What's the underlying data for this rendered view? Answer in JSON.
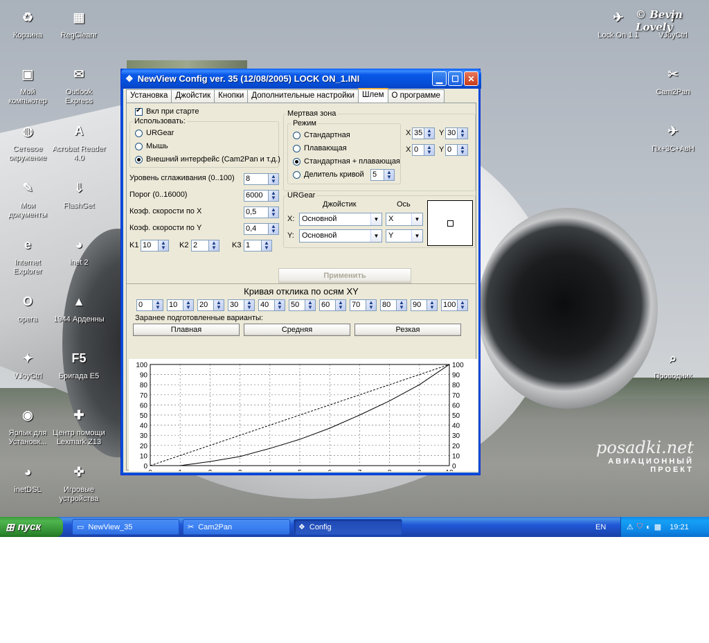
{
  "desktop": {
    "icons_left": [
      {
        "label": "Корзина",
        "glyph": "♻"
      },
      {
        "label": "RegCleanr",
        "glyph": "▦"
      },
      {
        "label": "Мой компьютер",
        "glyph": "▣"
      },
      {
        "label": "Outlook Express",
        "glyph": "✉"
      },
      {
        "label": "Сетевое окружение",
        "glyph": "◍"
      },
      {
        "label": "Acrobat Reader 4.0",
        "glyph": "A"
      },
      {
        "label": "Мои документы",
        "glyph": "✎"
      },
      {
        "label": "FlashGet",
        "glyph": "⇓"
      },
      {
        "label": "Internet Explorer",
        "glyph": "e"
      },
      {
        "label": "inet 2",
        "glyph": "◕"
      },
      {
        "label": "opera",
        "glyph": "O"
      },
      {
        "label": "1944 Арденны",
        "glyph": "▲"
      },
      {
        "label": "VJoyCtrl",
        "glyph": "✦"
      },
      {
        "label": "Бригада E5",
        "glyph": "F5"
      },
      {
        "label": "Ярлык для Установк...",
        "glyph": "◉"
      },
      {
        "label": "Центр помощи Lexmark Z13",
        "glyph": "✚"
      },
      {
        "label": "inetDSL",
        "glyph": "◕"
      },
      {
        "label": "Игровые устройства",
        "glyph": "✜"
      }
    ],
    "icons_right": [
      {
        "label": "Lock On 1.1",
        "glyph": "✈"
      },
      {
        "label": "VJoyCtrl",
        "glyph": "7"
      },
      {
        "label": "Cam2Pan",
        "glyph": "✂"
      },
      {
        "label": "Пх+3С+АвН",
        "glyph": "✈"
      },
      {
        "label": "Проводник",
        "glyph": "⌕"
      }
    ],
    "bevin_text": "© Bevin Lovely",
    "logo_big": "posadki.net",
    "logo_small": "АВИАЦИОННЫЙ ПРОЕКТ"
  },
  "window": {
    "title": "NewView Config ver. 35 (12/08/2005) LOCK ON_1.INI",
    "tabs": [
      {
        "label": "Установка"
      },
      {
        "label": "Джойстик"
      },
      {
        "label": "Кнопки"
      },
      {
        "label": "Дополнительные настройки"
      },
      {
        "label": "Шлем"
      },
      {
        "label": "О программе"
      }
    ],
    "startup_checkbox": "Вкл при старте",
    "use_group": {
      "title": "Использовать:",
      "options": [
        "URGear",
        "Мышь",
        "Внешний интерфейс (Cam2Pan и т.д.)"
      ],
      "selected": 2
    },
    "smoothing": {
      "label": "Уровень сглаживания (0..100)",
      "value": "8"
    },
    "threshold": {
      "label": "Порог (0..16000)",
      "value": "6000"
    },
    "speed_x": {
      "label": "Коэф. скорости по X",
      "value": "0,5"
    },
    "speed_y": {
      "label": "Коэф. скорости по Y",
      "value": "0,4"
    },
    "k1": {
      "label": "K1",
      "value": "10"
    },
    "k2": {
      "label": "K2",
      "value": "2"
    },
    "k3": {
      "label": "K3",
      "value": "1"
    },
    "deadzone": {
      "title": "Мертвая зона",
      "mode_title": "Режим",
      "modes": [
        "Стандартная",
        "Плавающая",
        "Стандартная + плавающая",
        "Делитель кривой"
      ],
      "selected": 2,
      "divider_value": "5",
      "x1_label": "X",
      "x1": "35",
      "y1_label": "Y",
      "y1": "30",
      "x2_label": "X",
      "x2": "0",
      "y2_label": "Y",
      "y2": "0"
    },
    "urgear": {
      "title": "URGear",
      "col_joystick": "Джойстик",
      "col_axis": "Ось",
      "x_label": "X:",
      "x_joystick": "Основной",
      "x_axis": "X",
      "y_label": "Y:",
      "y_joystick": "Основной",
      "y_axis": "Y"
    },
    "apply_button": "Применить",
    "curve": {
      "title": "Кривая отклика по осям XY",
      "points": [
        "0",
        "10",
        "20",
        "30",
        "40",
        "50",
        "60",
        "70",
        "80",
        "90",
        "100"
      ],
      "presets_label": "Заранее подготовленные варианты:",
      "presets": [
        "Плавная",
        "Средняя",
        "Резкая"
      ]
    }
  },
  "chart_data": {
    "type": "line",
    "title": "",
    "xlabel": "",
    "ylabel": "",
    "xlim": [
      0,
      10
    ],
    "ylim": [
      0,
      100
    ],
    "x_ticks": [
      "0",
      "1",
      "2",
      "3",
      "4",
      "5",
      "6",
      "7",
      "8",
      "9",
      "10"
    ],
    "y_ticks": [
      "0",
      "10",
      "20",
      "30",
      "40",
      "50",
      "60",
      "70",
      "80",
      "90",
      "100"
    ],
    "grid": true,
    "series": [
      {
        "style": "dashed",
        "x": [
          0,
          10
        ],
        "y": [
          0,
          100
        ]
      },
      {
        "style": "solid",
        "x": [
          0,
          1,
          2,
          3,
          4,
          5,
          6,
          7,
          8,
          9,
          10
        ],
        "y": [
          0,
          0,
          4,
          9,
          17,
          26,
          37,
          50,
          64,
          80,
          100
        ]
      }
    ]
  },
  "taskbar": {
    "start": "пуск",
    "tasks": [
      {
        "label": "NewView_35",
        "glyph": "▭"
      },
      {
        "label": "Cam2Pan",
        "glyph": "✂"
      },
      {
        "label": "Config",
        "glyph": "❖"
      }
    ],
    "lang": "EN",
    "time": "19:21"
  }
}
